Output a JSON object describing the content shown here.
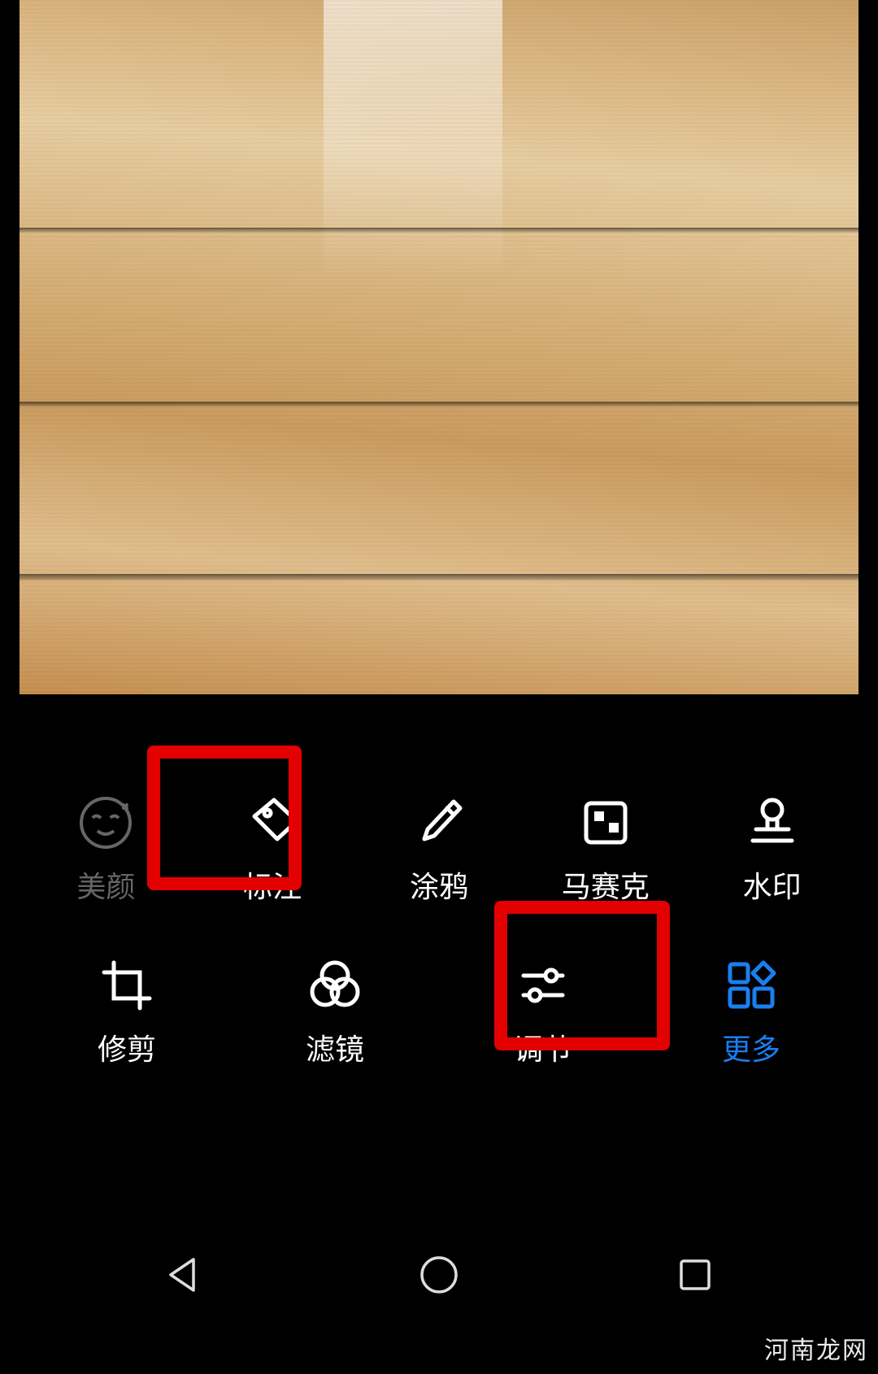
{
  "colors": {
    "accent": "#1a7ff0",
    "highlight": "#e30000",
    "disabled": "#666"
  },
  "tools_row1": [
    {
      "id": "beauty",
      "label": "美颜",
      "icon": "face-icon",
      "state": "disabled"
    },
    {
      "id": "annotate",
      "label": "标注",
      "icon": "tag-icon",
      "state": "normal"
    },
    {
      "id": "doodle",
      "label": "涂鸦",
      "icon": "brush-icon",
      "state": "normal"
    },
    {
      "id": "mosaic",
      "label": "马赛克",
      "icon": "mosaic-icon",
      "state": "normal"
    },
    {
      "id": "watermark",
      "label": "水印",
      "icon": "stamp-icon",
      "state": "normal"
    }
  ],
  "tools_row2": [
    {
      "id": "crop",
      "label": "修剪",
      "icon": "crop-icon",
      "state": "normal"
    },
    {
      "id": "filter",
      "label": "滤镜",
      "icon": "filter-icon",
      "state": "normal"
    },
    {
      "id": "adjust",
      "label": "调节",
      "icon": "sliders-icon",
      "state": "normal"
    },
    {
      "id": "more",
      "label": "更多",
      "icon": "grid-icon",
      "state": "active"
    }
  ],
  "highlighted_tools": [
    "annotate",
    "more"
  ],
  "watermark_text": "河南龙网"
}
